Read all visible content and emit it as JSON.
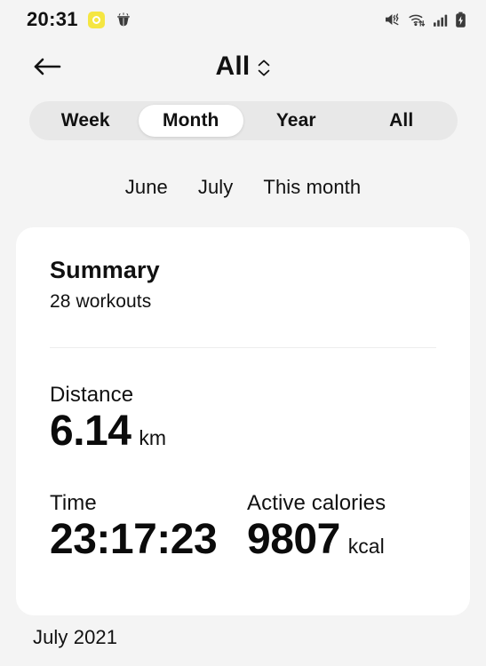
{
  "status_bar": {
    "clock": "20:31",
    "left_icons": [
      {
        "name": "snapchat-icon",
        "glyph": "rounded-square-circle",
        "color": "#F5E642"
      },
      {
        "name": "bug-shield-icon",
        "glyph": "bug",
        "color": "#3a3a3a"
      }
    ],
    "right_icons": [
      {
        "name": "mute-vibrate-icon"
      },
      {
        "name": "wifi-icon"
      },
      {
        "name": "cellular-signal-icon"
      },
      {
        "name": "battery-charging-icon"
      }
    ]
  },
  "header": {
    "back_label": "back",
    "title": "All",
    "selector_icon": "chevron-up-down-icon"
  },
  "range_tabs": {
    "selected": "Month",
    "items": [
      {
        "label": "Week",
        "active": false
      },
      {
        "label": "Month",
        "active": true
      },
      {
        "label": "Year",
        "active": false
      },
      {
        "label": "All",
        "active": false
      }
    ]
  },
  "month_chips": {
    "items": [
      {
        "label": "June"
      },
      {
        "label": "July"
      },
      {
        "label": "This month"
      }
    ]
  },
  "summary_card": {
    "title": "Summary",
    "workouts": "28 workouts",
    "distance": {
      "label": "Distance",
      "value": "6.14",
      "unit": "km"
    },
    "time": {
      "label": "Time",
      "value": "23:17:23",
      "unit": ""
    },
    "calories": {
      "label": "Active calories",
      "value": "9807",
      "unit": "kcal"
    }
  },
  "footer": {
    "period": "July 2021"
  },
  "colors": {
    "page_background": "#f4f4f4",
    "card_background": "#ffffff",
    "segment_track": "#e8e8e8",
    "segment_active": "#ffffff",
    "text_primary": "#111111",
    "divider": "#ededed",
    "accent_snapchat": "#F5E642"
  }
}
